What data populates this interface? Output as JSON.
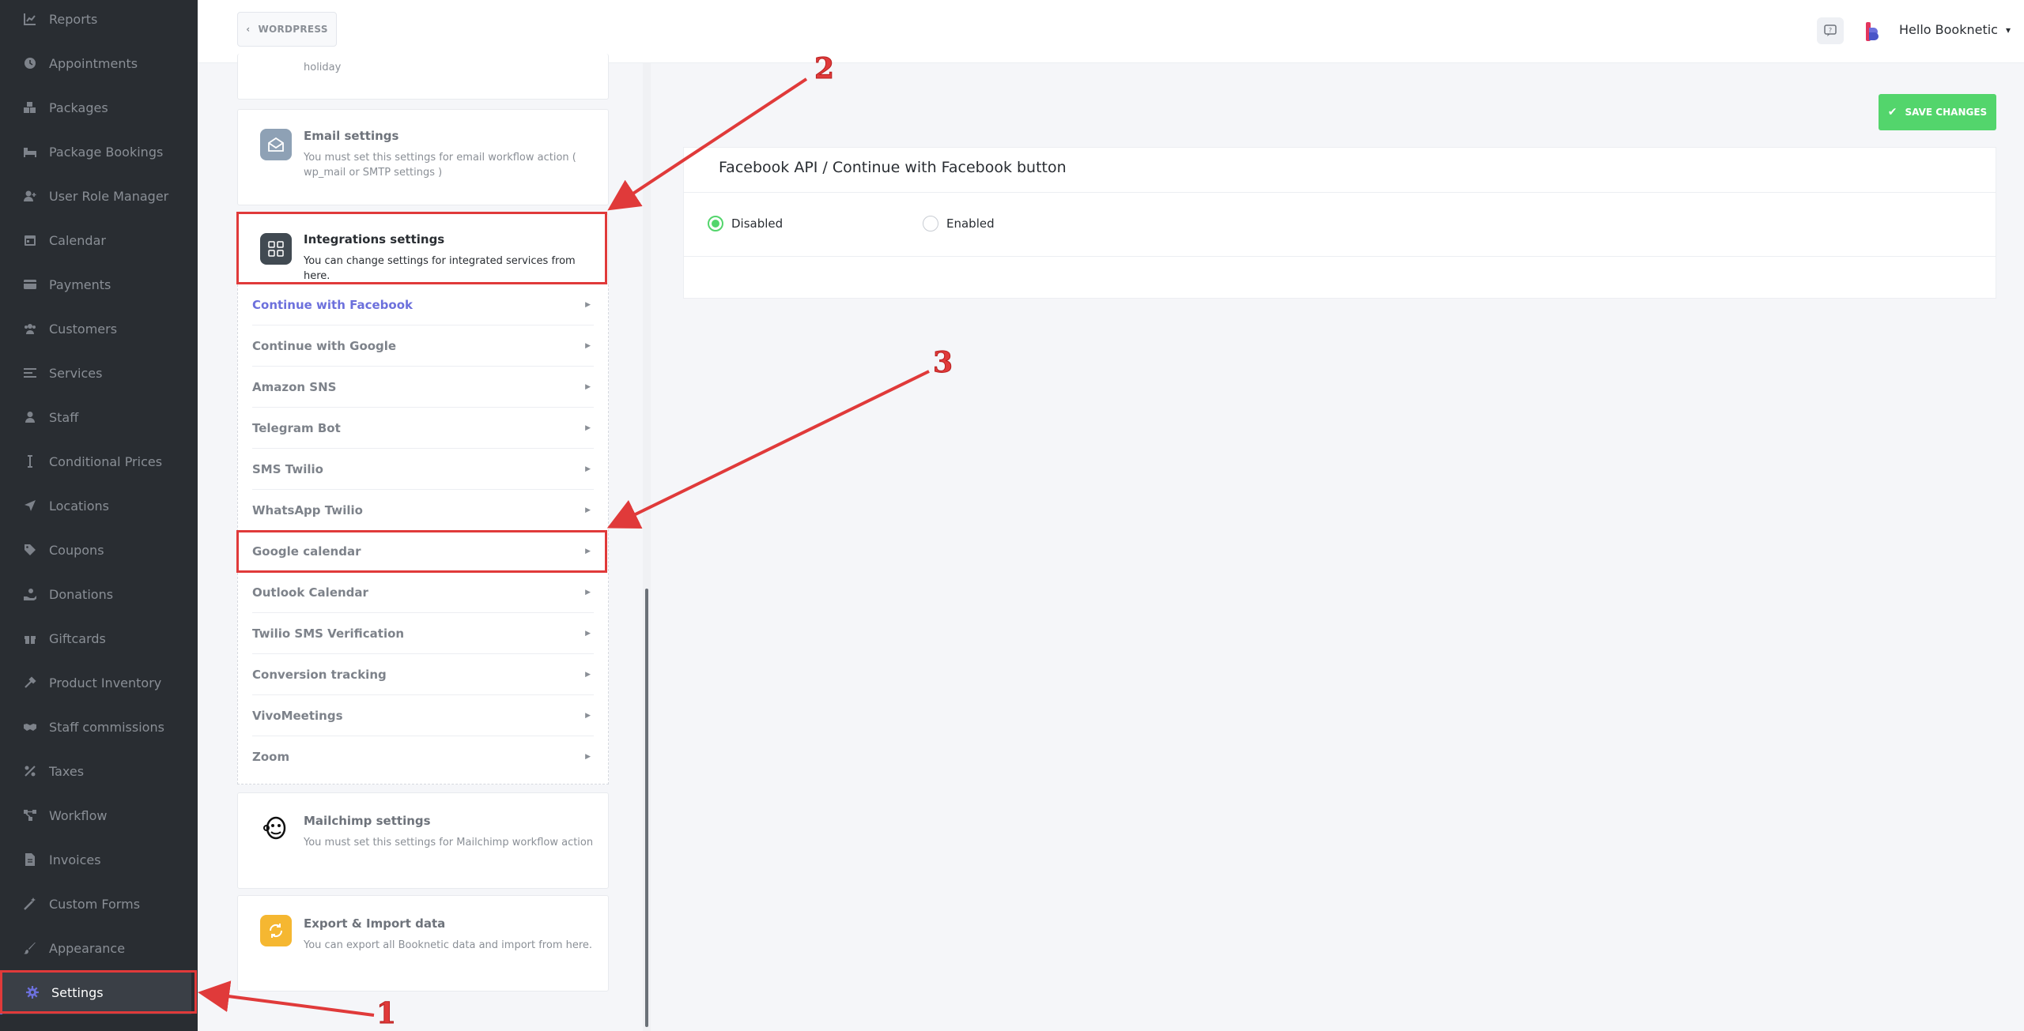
{
  "sidebar": {
    "items": [
      {
        "label": "Reports",
        "icon": "chart-icon"
      },
      {
        "label": "Appointments",
        "icon": "clock-icon"
      },
      {
        "label": "Packages",
        "icon": "boxes-icon"
      },
      {
        "label": "Package Bookings",
        "icon": "bed-icon"
      },
      {
        "label": "User Role Manager",
        "icon": "user-plus-icon"
      },
      {
        "label": "Calendar",
        "icon": "calendar-icon"
      },
      {
        "label": "Payments",
        "icon": "credit-card-icon"
      },
      {
        "label": "Customers",
        "icon": "users-icon"
      },
      {
        "label": "Services",
        "icon": "list-icon"
      },
      {
        "label": "Staff",
        "icon": "user-icon"
      },
      {
        "label": "Conditional Prices",
        "icon": "i-cursor-icon"
      },
      {
        "label": "Locations",
        "icon": "location-arrow-icon"
      },
      {
        "label": "Coupons",
        "icon": "tag-icon"
      },
      {
        "label": "Donations",
        "icon": "hand-holding-icon"
      },
      {
        "label": "Giftcards",
        "icon": "gift-icon"
      },
      {
        "label": "Product Inventory",
        "icon": "tools-icon"
      },
      {
        "label": "Staff commissions",
        "icon": "handshake-icon"
      },
      {
        "label": "Taxes",
        "icon": "percent-icon"
      },
      {
        "label": "Workflow",
        "icon": "workflow-icon"
      },
      {
        "label": "Invoices",
        "icon": "file-icon"
      },
      {
        "label": "Custom Forms",
        "icon": "magic-icon"
      },
      {
        "label": "Appearance",
        "icon": "brush-icon"
      },
      {
        "label": "Settings",
        "icon": "gear-icon"
      }
    ]
  },
  "header": {
    "back_label": "WORDPRESS",
    "greeting": "Hello Booknetic"
  },
  "settings_menu": {
    "holiday_fragment": "holiday",
    "email": {
      "title": "Email settings",
      "desc": "You must set this settings for email workflow action ( wp_mail or SMTP settings )"
    },
    "integrations": {
      "title": "Integrations settings",
      "desc": "You can change settings for integrated services from here."
    },
    "sub_items": [
      "Continue with Facebook",
      "Continue with Google",
      "Amazon SNS",
      "Telegram Bot",
      "SMS Twilio",
      "WhatsApp Twilio",
      "Google calendar",
      "Outlook Calendar",
      "Twilio SMS Verification",
      "Conversion tracking",
      "VivoMeetings",
      "Zoom"
    ],
    "mailchimp": {
      "title": "Mailchimp settings",
      "desc": "You must set this settings for Mailchimp workflow action"
    },
    "export": {
      "title": "Export & Import data",
      "desc": "You can export all Booknetic data and import from here."
    }
  },
  "main": {
    "save_label": "SAVE CHANGES",
    "panel_title": "Facebook API / Continue with Facebook button",
    "options": [
      {
        "label": "Disabled",
        "checked": true
      },
      {
        "label": "Enabled",
        "checked": false
      }
    ]
  },
  "annotations": {
    "numbers": [
      "1",
      "2",
      "3"
    ],
    "color": "#e03a3a"
  },
  "colors": {
    "sidebar_bg": "#292d32",
    "accent": "#6c70dc",
    "success": "#53d56c",
    "annotation": "#e03a3a"
  }
}
